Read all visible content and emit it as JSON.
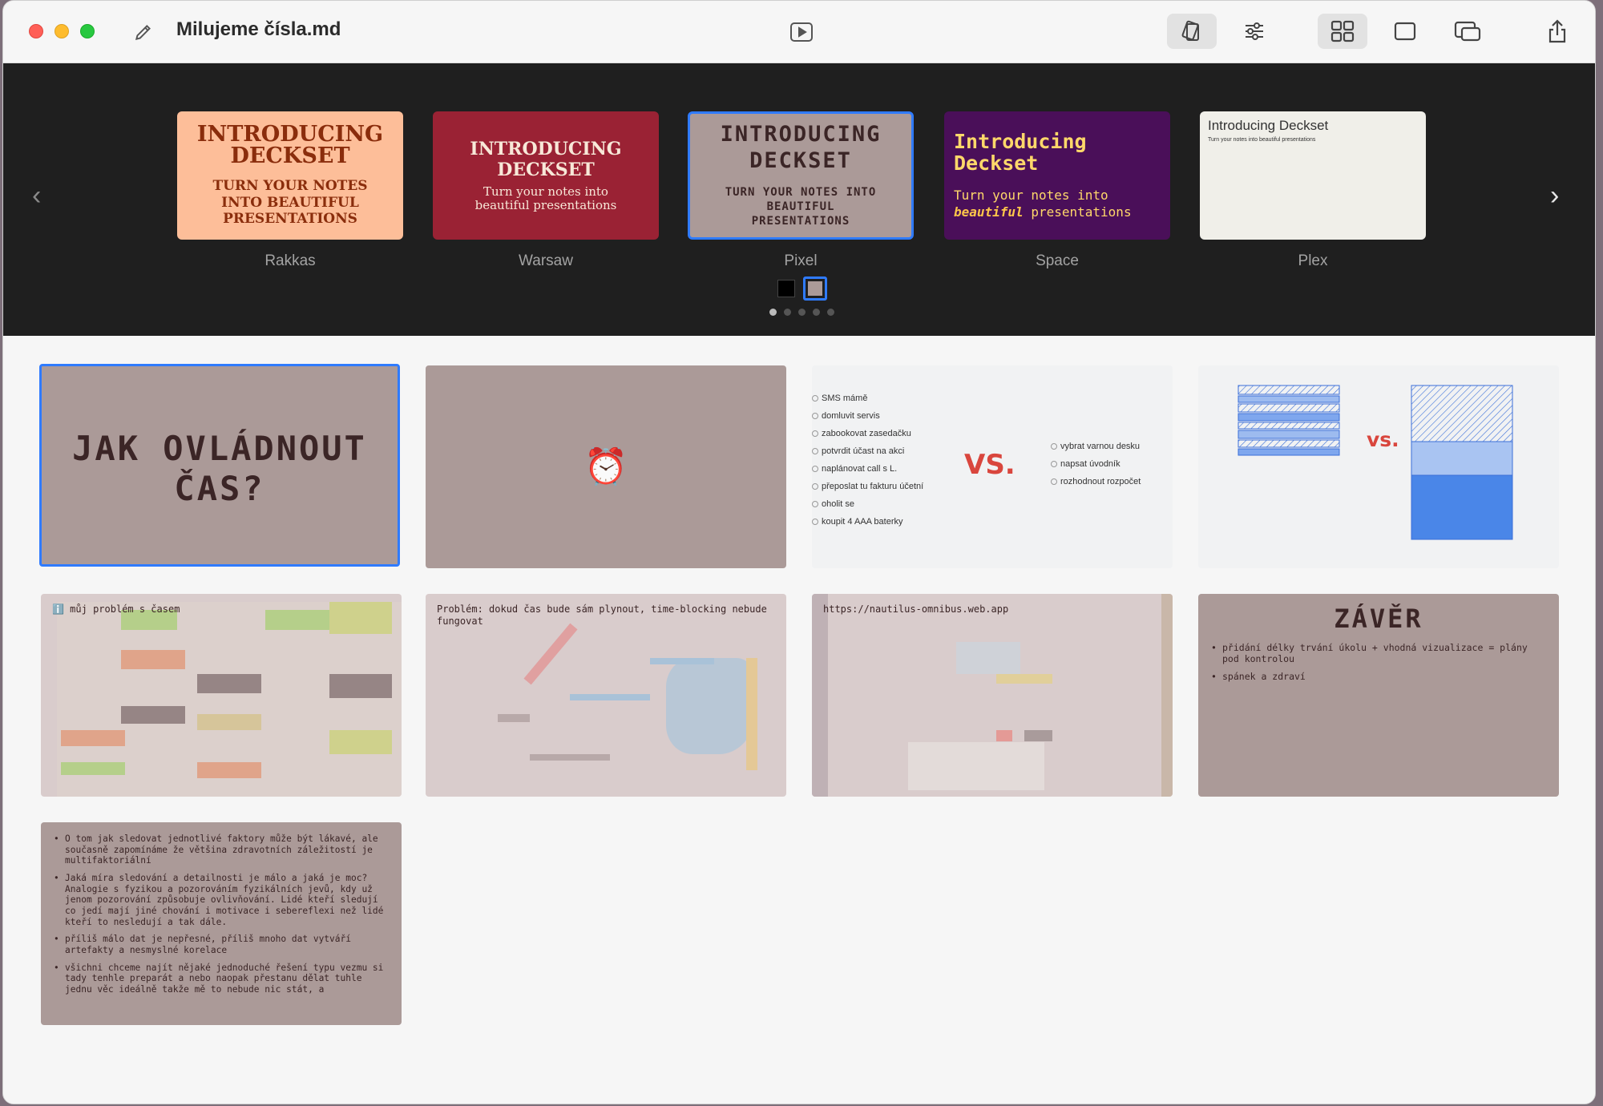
{
  "window": {
    "title": "Milujeme čísla.md"
  },
  "toolbar": {
    "icons": [
      "pencil-icon",
      "play-icon",
      "theme-icon",
      "sliders-icon",
      "grid-icon",
      "single-slide-icon",
      "windows-icon",
      "share-icon"
    ],
    "active_view": "grid"
  },
  "themes": {
    "items": [
      {
        "name": "Rakkas",
        "heading": "INTRODUCING DECKSET",
        "sub": "TURN YOUR NOTES INTO BEAUTIFUL PRESENTATIONS",
        "color": "#fdbe99"
      },
      {
        "name": "Warsaw",
        "heading": "INTRODUCING DECKSET",
        "sub": "Turn your notes into beautiful presentations",
        "color": "#9a2234"
      },
      {
        "name": "Pixel",
        "heading": "INTRODUCING DECKSET",
        "sub": "TURN YOUR NOTES INTO BEAUTIFUL PRESENTATIONS",
        "color": "#ab9a98",
        "selected": true
      },
      {
        "name": "Space",
        "heading": "Introducing Deckset",
        "sub_a": "Turn your notes into",
        "sub_em": "beautiful",
        "sub_b": "presentations",
        "color": "#4a0f59"
      },
      {
        "name": "Plex",
        "heading": "Introducing Deckset",
        "sub": "Turn your notes into beautiful presentations",
        "color": "#f0efe9"
      }
    ],
    "variants": [
      "#000000",
      "#ab9a98"
    ],
    "selected_variant": 1,
    "page_count": 5,
    "current_page": 1
  },
  "slides": {
    "s1": {
      "title": "JAK OVLÁDNOUT ČAS?",
      "line1": "JAK OVLÁDNOUT",
      "line2": "ČAS?"
    },
    "s2": {
      "emoji": "⏰"
    },
    "s3": {
      "left": [
        "SMS mámě",
        "domluvit servis",
        "zabookovat zasedačku",
        "potvrdit účast na akci",
        "naplánovat call s L.",
        "přeposlat tu fakturu účetní",
        "oholit se",
        "koupit 4 AAA baterky"
      ],
      "vs": "VS.",
      "right": [
        "vybrat varnou desku",
        "napsat úvodník",
        "rozhodnout rozpočet"
      ]
    },
    "s4": {
      "vs": "vs."
    },
    "s5": {
      "caption": "ℹ️ můj problém s časem"
    },
    "s6": {
      "caption": "Problém: dokud čas bude sám plynout, time-blocking nebude fungovat"
    },
    "s7": {
      "caption": "https://nautilus-omnibus.web.app"
    },
    "s8": {
      "title": "ZÁVĚR",
      "bullets": [
        "přidání délky trvání úkolu + vhodná vizualizace = plány pod kontrolou",
        "spánek a zdraví"
      ]
    },
    "s9": {
      "bullets": [
        "O tom jak sledovat jednotlivé faktory může být lákavé, ale současně zapomínáme že většina zdravotních záležitostí je multifaktoriální",
        "Jaká míra sledování a detailnosti je málo a jaká je moc? Analogie s fyzikou a pozorováním fyzikálních jevů, kdy už jenom pozorování způsobuje ovlivňování. Lidé kteří sledují co jedí mají jiné chování i motivace i sebereflexi než lidé kteří to nesledují a tak dále.",
        "příliš málo dat je nepřesné, příliš mnoho dat vytváří artefakty a nesmyslné korelace",
        "všichni chceme najít nějaké jednoduché řešení typu vezmu si tady tenhle preparát a nebo naopak přestanu dělat tuhle jednu věc ideálně takže mě to nebude nic stát, a"
      ]
    }
  }
}
